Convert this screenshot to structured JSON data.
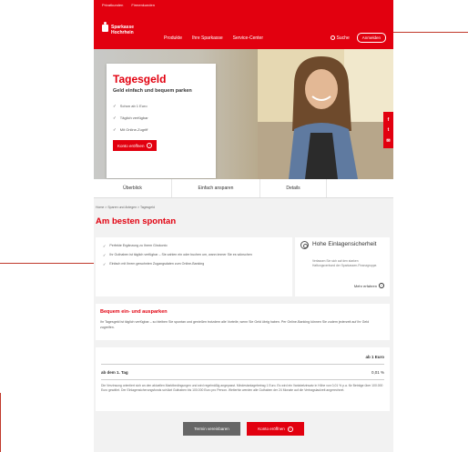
{
  "topbar": {
    "links": [
      "Privatkunden",
      "Firmenkunden"
    ]
  },
  "logo": {
    "line1": "Sparkasse",
    "line2": "Hochrhein"
  },
  "nav": {
    "items": [
      "Produkte",
      "Ihre Sparkasse",
      "Service-Center"
    ]
  },
  "header": {
    "search": "Suche",
    "login": "Anmelden"
  },
  "hero": {
    "title": "Tagesgeld",
    "subtitle": "Geld einfach und bequem parken",
    "bullets": [
      "Schon ab 1 Euro",
      "Täglich verfügbar",
      "Mit Online-Zugriff"
    ],
    "button": "Konto eröffnen"
  },
  "social": {
    "items": [
      "f",
      "t",
      "✉"
    ]
  },
  "tabs": {
    "items": [
      "Überblick",
      "Einfach ansparen",
      "Details"
    ]
  },
  "breadcrumb": "Home > Sparen und Anlegen > Tagesgeld",
  "page_title": "Am besten spontan",
  "features": {
    "items": [
      "Perfekte Ergänzung zu Ihrem Girokonto",
      "Ihr Guthaben ist täglich verfügbar – Sie zahlen ein oder buchen um, wann immer Sie es wünschen",
      "Einfach mit Ihrem gewohnten Zugangsdaten zum Online-Banking"
    ]
  },
  "security": {
    "title": "Hohe Einlagensicherheit",
    "text": "Verlassen Sie sich auf den starken Haftungsverbund der Sparkassen-Finanzgruppe.",
    "link": "Mehr erfahren"
  },
  "saving": {
    "title": "Bequem ein- und ausparken",
    "text": "Ihr Tagesgeld ist täglich verfügbar – so bleiben Sie spontan und genießen trotzdem alle Vorteile, wenn Sie Geld übrig haben. Per Online-Banking können Sie zudem jederzeit auf Ihr Geld zugreifen."
  },
  "rates": {
    "header": "ab 1 Euro",
    "row_label": "ab dem 1. Tag",
    "row_value": "0,01 %",
    "text": "Die Verzinsung orientiert sich an den aktuellen Marktbedingungen und wird regelmäßig angepasst. Mindestanlagebetrag 1 Euro. Es wird ein Variabelzinsatz in Höhe von 0,01 % p.a. für Beträge über 100.000 Euro gewährt. Der Einlagensicherungsfonds schützt Guthaben bis 100.000 Euro pro Person. Weiterhin werden alle Guthaben der 24 Monate auf die Vertragslaufzeit angerechnet."
  },
  "buttons": {
    "contact": "Termin vereinbaren",
    "open": "Konto eröffnen"
  },
  "colors": {
    "brand_red": "#e2000f",
    "secondary": "#666666"
  }
}
